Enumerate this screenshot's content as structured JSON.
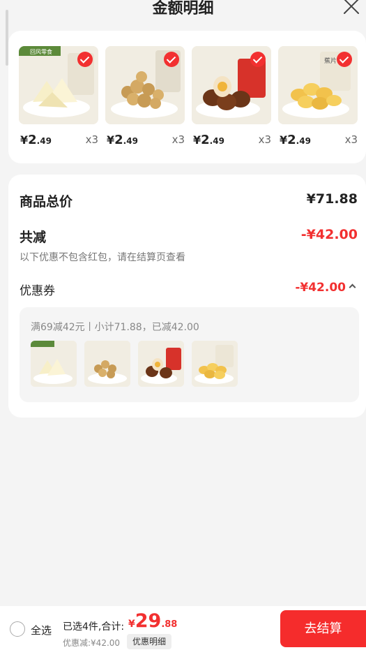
{
  "header": {
    "title": "金额明细"
  },
  "products": [
    {
      "icon": "milk-flakes-image",
      "price_symbol": "¥",
      "price_int": "2",
      "price_dec": ".49",
      "qty": "x3",
      "brand": "回风零食"
    },
    {
      "icon": "puffed-snack-image",
      "price_symbol": "¥",
      "price_int": "2",
      "price_dec": ".49",
      "qty": "x3"
    },
    {
      "icon": "braised-eggs-image",
      "price_symbol": "¥",
      "price_int": "2",
      "price_dec": ".49",
      "qty": "x3"
    },
    {
      "icon": "banana-chips-image",
      "price_symbol": "¥",
      "price_int": "2",
      "price_dec": ".49",
      "qty": "x3",
      "pack_label": "蕉片"
    }
  ],
  "summary": {
    "total_label": "商品总价",
    "total_value": "¥71.88",
    "discount_label": "共减",
    "discount_value": "-¥42.00",
    "note": "以下优惠不包含红包，请在结算页查看",
    "coupon_label": "优惠券",
    "coupon_value": "-¥42.00",
    "coupon_detail": "满69减42元丨小计71.88，已减42.00"
  },
  "footer": {
    "select_all": "全选",
    "selected_info": "已选4件,合计:",
    "total_symbol": "¥",
    "total_int": "29",
    "total_dec": ".88",
    "discount_info": "优惠减:¥42.00",
    "detail_button": "优惠明细",
    "checkout_button": "去结算"
  },
  "colors": {
    "accent": "#f23030",
    "checkout": "#f52c2c"
  }
}
